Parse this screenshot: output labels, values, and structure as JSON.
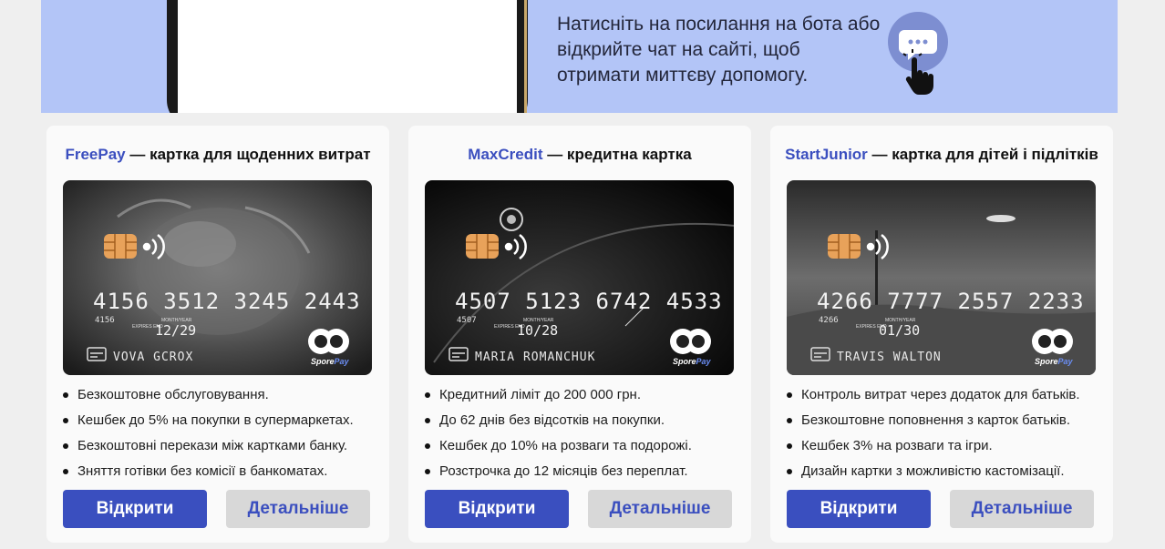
{
  "banner": {
    "text": "Натисніть на посилання на бота або відкрийте чат на сайті, щоб отримати миттєву допомогу.",
    "icons": [
      "chat-bubble-icon",
      "pointer-hand-icon"
    ]
  },
  "cards": [
    {
      "brand": "FreePay",
      "title_rest": " — картка для щоденних витрат",
      "card_number": "4156 3512 3245 2443",
      "card_prefix": "4156",
      "expiry": "12/29",
      "holder": "VOVA GCROX",
      "features": [
        "Безкоштовне обслуговування.",
        "Кешбек до 5% на покупки в супермаркетах.",
        "Безкоштовні перекази між картками банку.",
        "Зняття готівки без комісії в банкоматах."
      ],
      "open_label": "Відкрити",
      "details_label": "Детальніше"
    },
    {
      "brand": "MaxCredit",
      "title_rest": "  — кредитна картка",
      "card_number": "4507 5123 6742 4533",
      "card_prefix": "4507",
      "expiry": "10/28",
      "holder": "MARIA ROMANCHUK",
      "features": [
        "Кредитний ліміт до 200 000 грн.",
        "До 62 днів без відсотків на покупки.",
        "Кешбек до 10% на розваги та подорожі.",
        "Розстрочка до 12 місяців без переплат."
      ],
      "open_label": "Відкрити",
      "details_label": "Детальніше"
    },
    {
      "brand": "StartJunior",
      "title_rest": " — картка для дітей і підлітків",
      "card_number": "4266 7777 2557 2233",
      "card_prefix": "4266",
      "expiry": "01/30",
      "holder": "TRAVIS WALTON",
      "features": [
        "Контроль витрат через додаток для батьків.",
        "Безкоштовне поповнення з карток батьків.",
        "Кешбек 3% на розваги та ігри.",
        "Дизайн картки з можливістю кастомізації."
      ],
      "open_label": "Відкрити",
      "details_label": "Детальніше"
    }
  ],
  "card_common": {
    "expires_label": "EXPIRES END",
    "month_year_label": "MONTH/YEAR",
    "logo_text": "SporePay"
  },
  "colors": {
    "accent": "#3a4fbf",
    "banner": "#b3c5f7",
    "chat": "#7d8ed1"
  }
}
